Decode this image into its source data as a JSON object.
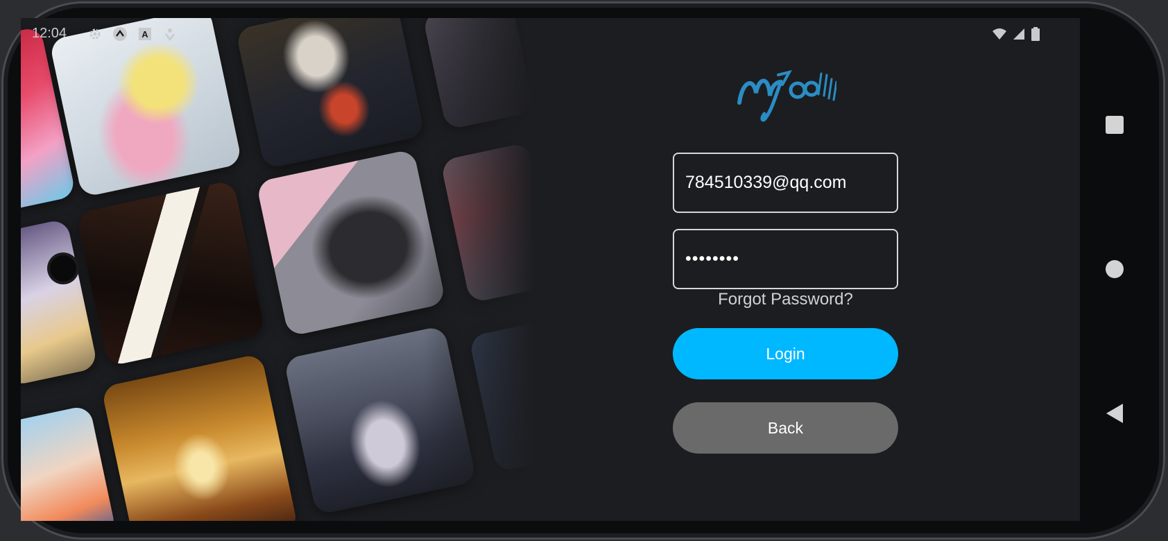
{
  "status_bar": {
    "time": "12:04",
    "left_icons": [
      "gear-icon",
      "caret-up-icon",
      "font-a-icon",
      "download-icon"
    ],
    "right_icons": [
      "wifi-icon",
      "cellular-signal-icon",
      "battery-icon"
    ]
  },
  "collage": {
    "description_icons": [
      "violin-girl-image",
      "beethoven-portrait-image",
      "piano-keys-image",
      "guitar-image",
      "concert-hall-image",
      "band-group-image"
    ]
  },
  "login": {
    "logo_text": "MyGO!!!!!",
    "email_value": "784510339@qq.com",
    "password_value": "••••••••",
    "forgot_password_label": "Forgot Password?",
    "login_button_label": "Login",
    "back_button_label": "Back"
  },
  "colors": {
    "accent": "#00b8ff",
    "back_button": "#6a6a6b",
    "background": "#1c1d20",
    "logo": "#2a8dc4"
  },
  "navigation_bar": {
    "icons": [
      "recents-square-icon",
      "home-circle-icon",
      "back-triangle-icon"
    ]
  }
}
